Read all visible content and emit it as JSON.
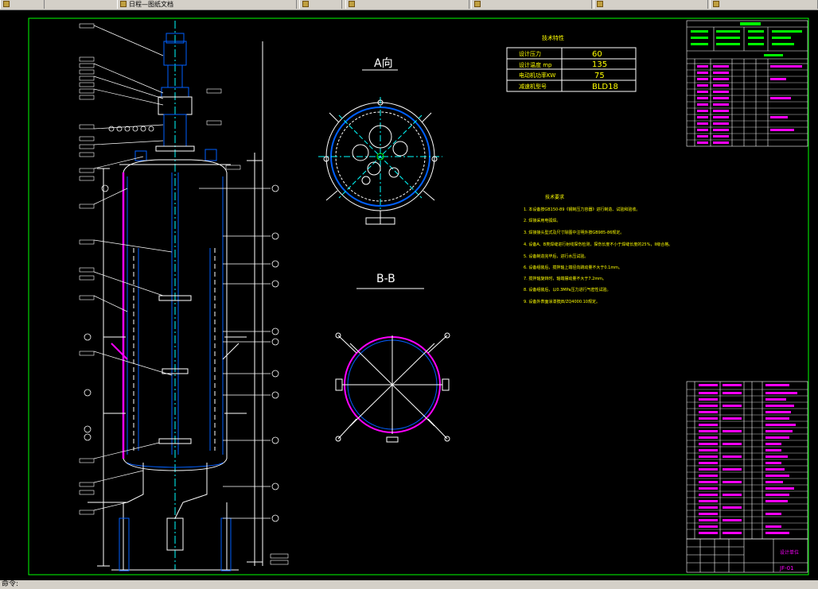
{
  "taskbar": {
    "tabs": [
      {
        "label": ""
      },
      {
        "label": "日程—图纸文档"
      },
      {
        "label": ""
      },
      {
        "label": ""
      },
      {
        "label": ""
      },
      {
        "label": ""
      },
      {
        "label": ""
      }
    ]
  },
  "views": {
    "view_a_title": "A向",
    "view_b_title": "B-B"
  },
  "spec_table": {
    "title": "技术特性",
    "rows": [
      {
        "label": "设计压力",
        "value": "60"
      },
      {
        "label": "设计温度 mp",
        "value": "135"
      },
      {
        "label": "电动机功率KW",
        "value": "75"
      },
      {
        "label": "减速机型号",
        "value": "BLD18"
      }
    ]
  },
  "notes": {
    "title": "技术要求",
    "lines": [
      "1. 本设备按GB150-89《钢制压力容器》进行制造、试验和验收。",
      "2. 焊接采用电弧焊。",
      "3. 焊接接头型式及尺寸除图中注明外按GB985-86规定。",
      "4. 设备A、B类焊缝进行射线探伤检测，探伤长度不小于焊缝长度的25%，II级合格。",
      "5. 设备制造完毕后，进行水压试验。",
      "6. 设备组装后，搅拌轴上端径向跳动量不大于0.1mm。",
      "7. 搅拌轴旋转时，轴端摆动量不大于7.2mm。",
      "8. 设备组装后，以0.3MPa压力进行气密性试验。",
      "9. 设备外表面涂漆按JB/ZQ4000.10规定。"
    ]
  },
  "title_block": {
    "drawing_number": "JF-01",
    "company": "设计单位"
  },
  "status": {
    "command_prompt": "命令:"
  }
}
